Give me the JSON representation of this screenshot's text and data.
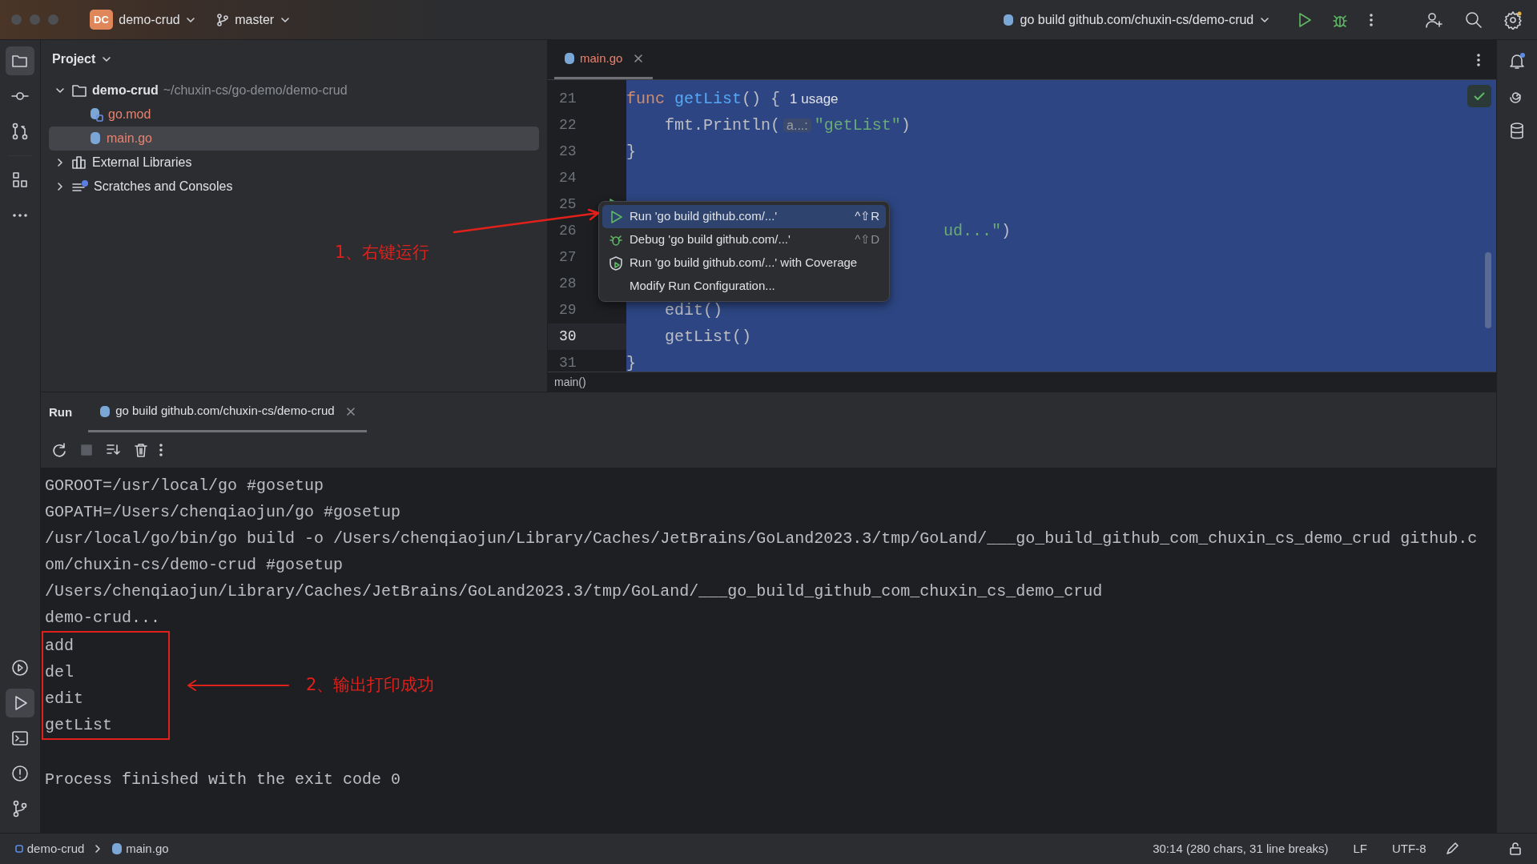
{
  "title_bar": {
    "project_badge": "DC",
    "project": "demo-crud",
    "branch": "master",
    "run_config": "go build github.com/chuxin-cs/demo-crud"
  },
  "left_toolbar": {
    "top": [
      {
        "kind": "folder",
        "selected": true
      },
      {
        "kind": "commit",
        "selected": false
      },
      {
        "kind": "pull",
        "selected": false
      },
      {
        "kind": "structure",
        "selected": false
      },
      {
        "kind": "more",
        "selected": false
      }
    ],
    "bottom": [
      {
        "kind": "services",
        "selected": false
      },
      {
        "kind": "run",
        "selected": true
      },
      {
        "kind": "terminal",
        "selected": false
      },
      {
        "kind": "problems",
        "selected": false
      },
      {
        "kind": "git",
        "selected": false
      }
    ]
  },
  "project_panel": {
    "title": "Project",
    "tree": [
      {
        "kind": "folder",
        "name": "demo-crud",
        "path": "~/chuxin-cs/go-demo/demo-crud",
        "expanded": true,
        "selected": false,
        "children": [
          {
            "kind": "gomod",
            "name": "go.mod",
            "selected": false
          },
          {
            "kind": "gofile",
            "name": "main.go",
            "selected": true
          }
        ]
      },
      {
        "kind": "library",
        "name": "External Libraries",
        "expanded": false,
        "selected": false
      },
      {
        "kind": "scratches",
        "name": "Scratches and Consoles",
        "expanded": false,
        "selected": false
      }
    ]
  },
  "editor": {
    "tabs": [
      {
        "label": "main.go",
        "selected": true
      }
    ],
    "lines": [
      {
        "number": "21",
        "current": false,
        "tokens": [
          {
            "kind": "keyword",
            "text": "func "
          },
          {
            "kind": "function",
            "text": "getList"
          },
          {
            "kind": "plain",
            "text": "() {"
          },
          {
            "kind": "usage",
            "text": "1 usage"
          }
        ]
      },
      {
        "number": "22",
        "current": false,
        "tokens": [
          {
            "kind": "plain",
            "text": "    fmt.Println("
          },
          {
            "kind": "hint",
            "text": "a...:"
          },
          {
            "kind": "string",
            "text": "\"getList\""
          },
          {
            "kind": "plain",
            "text": ")"
          }
        ]
      },
      {
        "number": "23",
        "current": false,
        "tokens": [
          {
            "kind": "plain",
            "text": "}"
          }
        ]
      },
      {
        "number": "24",
        "current": false
      },
      {
        "number": "25",
        "current": false,
        "run_marker": true
      },
      {
        "number": "26",
        "current": false,
        "covered": true,
        "tokens": [
          {
            "kind": "string",
            "text": "ud...\""
          },
          {
            "kind": "plain",
            "text": ")"
          }
        ]
      },
      {
        "number": "27",
        "current": false
      },
      {
        "number": "28",
        "current": false
      },
      {
        "number": "29",
        "current": false,
        "tokens": [
          {
            "kind": "plain",
            "text": "    edit()"
          }
        ]
      },
      {
        "number": "30",
        "current": true,
        "tokens": [
          {
            "kind": "plain",
            "text": "    getList()"
          }
        ]
      },
      {
        "number": "31",
        "current": false,
        "tokens": [
          {
            "kind": "plain",
            "text": "}"
          }
        ]
      }
    ],
    "breadcrumb": "main()"
  },
  "context_menu": {
    "items": [
      {
        "kind": "run",
        "label": "Run 'go build github.com/...'",
        "shortcut": "^⇧R",
        "selected": true
      },
      {
        "kind": "debug",
        "label": "Debug 'go build github.com/...'",
        "shortcut": "^⇧D",
        "selected": false
      },
      {
        "kind": "coverage",
        "label": "Run 'go build github.com/...' with Coverage",
        "selected": false
      },
      {
        "kind": "plain",
        "label": "Modify Run Configuration...",
        "selected": false
      }
    ]
  },
  "annotation": "1、右键运行",
  "run_panel": {
    "title": "Run",
    "tabs": [
      {
        "label": "go build github.com/chuxin-cs/demo-crud",
        "selected": true
      }
    ],
    "toolbar": [
      {
        "kind": "rerun",
        "disabled": false
      },
      {
        "kind": "stop",
        "disabled": true
      },
      {
        "kind": "scroll",
        "disabled": false
      },
      {
        "kind": "clear",
        "disabled": false
      },
      {
        "kind": "more",
        "disabled": false
      }
    ],
    "output": [
      {
        "text": "GOROOT=/usr/local/go #gosetup",
        "boxed": false
      },
      {
        "text": "GOPATH=/Users/chenqiaojun/go #gosetup",
        "boxed": false
      },
      {
        "text": "/usr/local/go/bin/go build -o /Users/chenqiaojun/Library/Caches/JetBrains/GoLand2023.3/tmp/GoLand/___go_build_github_com_chuxin_cs_demo_crud github.com/chuxin-cs/demo-crud #gosetup",
        "boxed": false
      },
      {
        "text": "/Users/chenqiaojun/Library/Caches/JetBrains/GoLand2023.3/tmp/GoLand/___go_build_github_com_chuxin_cs_demo_crud",
        "boxed": false
      },
      {
        "text": "demo-crud...",
        "boxed": false
      },
      {
        "text": "add",
        "boxed": true
      },
      {
        "text": "del",
        "boxed": true
      },
      {
        "text": "edit",
        "boxed": true
      },
      {
        "text": "getList",
        "boxed": true
      },
      {
        "boxed": false
      },
      {
        "text": "Process finished with the exit code 0",
        "boxed": false
      }
    ],
    "box_note": "2、输出打印成功"
  },
  "status_bar": {
    "path": [
      {
        "kind": "module",
        "label": "demo-crud"
      },
      {
        "kind": "gofile",
        "label": "main.go"
      }
    ],
    "position": "30:14 (280 chars, 31 line breaks)",
    "line_separator": "LF",
    "encoding": "UTF-8"
  }
}
